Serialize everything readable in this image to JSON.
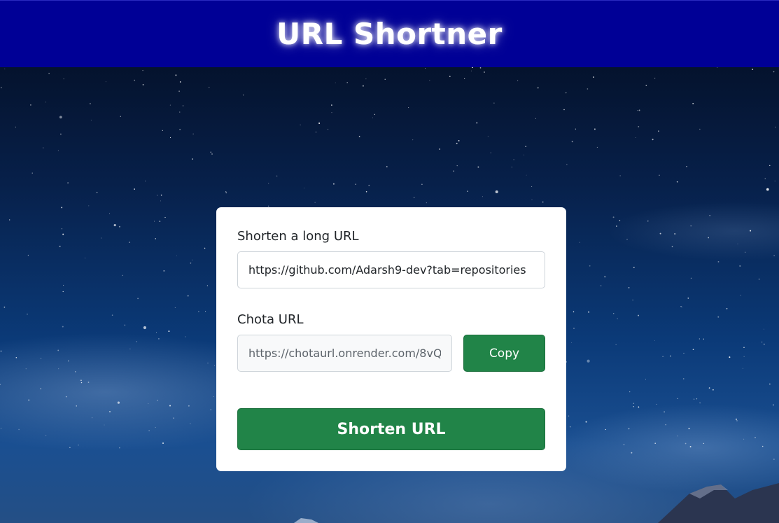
{
  "header": {
    "title": "URL Shortner"
  },
  "form": {
    "long_url_label": "Shorten a long URL",
    "long_url_value": "https://github.com/Adarsh9-dev?tab=repositories",
    "short_url_label": "Chota URL",
    "short_url_value": "https://chotaurl.onrender.com/8vQ",
    "copy_label": "Copy",
    "submit_label": "Shorten URL"
  },
  "colors": {
    "header_bg": "#000096",
    "button_green": "#218448",
    "card_bg": "#ffffff"
  }
}
